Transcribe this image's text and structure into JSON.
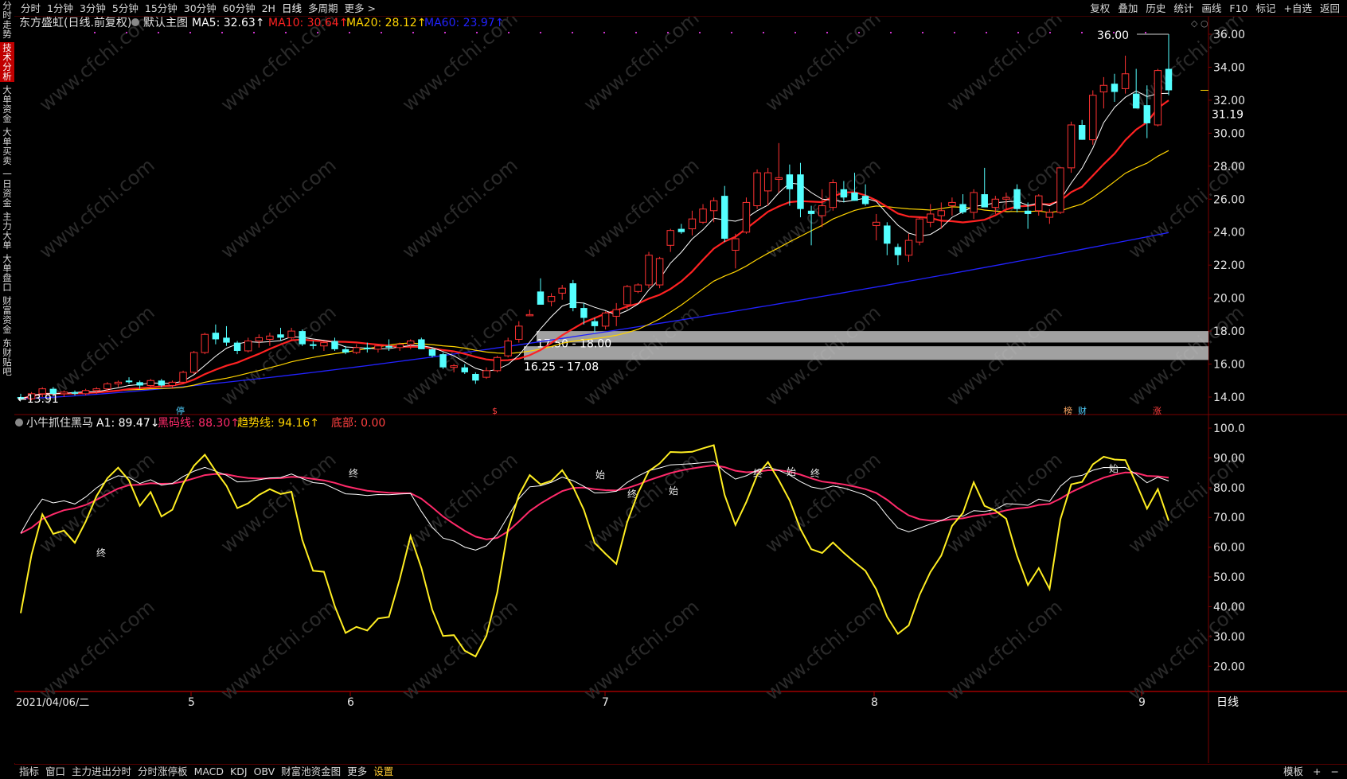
{
  "top_tabs": [
    "分时",
    "1分钟",
    "3分钟",
    "5分钟",
    "15分钟",
    "30分钟",
    "60分钟",
    "2H",
    "日线",
    "多周期",
    "更多 >"
  ],
  "top_tabs_selected": "日线",
  "top_right_buttons": [
    "复权",
    "叠加",
    "历史",
    "统计",
    "画线",
    "F10",
    "标记",
    "+自选",
    "返回"
  ],
  "sidebar_items": [
    "分时走势",
    "技术分析",
    "大单资金",
    "大单买卖",
    "一日资金",
    "主力大单",
    "大单盘口",
    "财富资金",
    "东财贴吧"
  ],
  "sidebar_active": "技术分析",
  "bottom_tabs": [
    "指标",
    "窗口",
    "主力进出分时",
    "分时涨停板",
    "MACD",
    "KDJ",
    "OBV",
    "财富池资金图",
    "更多",
    "设置"
  ],
  "bottom_tabs_selected": "设置",
  "bottom_right_buttons": [
    "模板",
    "+",
    "−"
  ],
  "main_panel": {
    "stock_title": "东方盛虹(日线.前复权)",
    "main_chart_label": "默认主图",
    "ma_labels": [
      {
        "text": "MA5: 32.63↑",
        "color": "#ffffff"
      },
      {
        "text": "MA10: 30.64↑",
        "color": "#ff2222"
      },
      {
        "text": "MA20: 28.12↑",
        "color": "#ffd400"
      },
      {
        "text": "MA60: 23.97↑",
        "color": "#2222ff"
      }
    ],
    "price_axis": [
      "36.00",
      "34.00",
      "32.00",
      "30.00",
      "28.00",
      "26.00",
      "24.00",
      "22.00",
      "20.00",
      "18.00",
      "16.00",
      "14.00"
    ],
    "current_price": "31.19",
    "high_marker": "36.00",
    "low_marker": "13.91",
    "zone_labels": [
      "17.50 - 18.00",
      "16.25 - 17.08"
    ],
    "event_markers": [
      {
        "text": "停",
        "color": "#50d0ff"
      },
      {
        "text": "$",
        "color": "#ff4040"
      },
      {
        "text": "榜",
        "color": "#ffaa66"
      },
      {
        "text": "财",
        "color": "#50d0ff"
      },
      {
        "text": "涨",
        "color": "#ff4040"
      }
    ],
    "watermark": "www.cfchi.com"
  },
  "sub_panel": {
    "title": "小牛抓住黑马",
    "labels": [
      {
        "text": "A1: 89.47↓",
        "color": "#ffffff"
      },
      {
        "text": "黑码线: 88.30↑",
        "color": "#ff2a6a"
      },
      {
        "text": "趋势线: 94.16↑",
        "color": "#ffd400"
      },
      {
        "text": "底部: 0.00",
        "color": "#ff4040"
      }
    ],
    "axis": [
      "100.0",
      "90.00",
      "80.00",
      "70.00",
      "60.00",
      "50.00",
      "40.00",
      "30.00",
      "20.00"
    ],
    "signal_markers": [
      "终",
      "终",
      "始",
      "终",
      "始",
      "终",
      "始",
      "终",
      "始"
    ]
  },
  "x_axis": {
    "date_label": "2021/04/06/二",
    "month_ticks": [
      "5",
      "6",
      "7",
      "8",
      "9"
    ]
  },
  "period_label": "日线",
  "colors": {
    "up": "#ff3232",
    "down": "#54ffff",
    "ma5": "#ffffff",
    "ma10": "#ff2222",
    "ma20": "#ffd400",
    "ma60": "#2222ff",
    "a1": "#ffffff",
    "black_horse": "#ff2a6a",
    "trend": "#ffee22",
    "axis_text": "#e6e6e6",
    "grid_border": "#7a0000"
  },
  "chart_data": {
    "type": "candlestick",
    "candles": [
      [
        14.0,
        14.2,
        13.8,
        13.91
      ],
      [
        13.9,
        14.3,
        13.8,
        14.2
      ],
      [
        14.2,
        14.6,
        14.0,
        14.5
      ],
      [
        14.5,
        14.6,
        14.1,
        14.2
      ],
      [
        14.2,
        14.4,
        14.0,
        14.3
      ],
      [
        14.3,
        14.4,
        14.1,
        14.2
      ],
      [
        14.2,
        14.5,
        14.1,
        14.4
      ],
      [
        14.4,
        14.6,
        14.2,
        14.5
      ],
      [
        14.5,
        14.9,
        14.3,
        14.8
      ],
      [
        14.8,
        15.0,
        14.6,
        14.9
      ],
      [
        15.0,
        15.2,
        14.8,
        14.9
      ],
      [
        14.9,
        15.0,
        14.5,
        14.7
      ],
      [
        14.7,
        15.1,
        14.6,
        15.0
      ],
      [
        15.0,
        15.1,
        14.6,
        14.7
      ],
      [
        14.7,
        15.0,
        14.5,
        14.9
      ],
      [
        14.9,
        15.6,
        14.8,
        15.5
      ],
      [
        15.5,
        16.8,
        15.4,
        16.7
      ],
      [
        16.7,
        17.9,
        16.6,
        17.8
      ],
      [
        17.9,
        18.4,
        17.2,
        17.5
      ],
      [
        17.6,
        18.3,
        17.1,
        17.3
      ],
      [
        17.3,
        17.4,
        16.6,
        16.8
      ],
      [
        16.8,
        17.6,
        16.7,
        17.4
      ],
      [
        17.4,
        17.8,
        17.0,
        17.6
      ],
      [
        17.5,
        17.9,
        17.1,
        17.7
      ],
      [
        17.8,
        18.2,
        17.4,
        17.6
      ],
      [
        17.6,
        18.2,
        17.4,
        18.0
      ],
      [
        18.0,
        18.1,
        17.1,
        17.2
      ],
      [
        17.2,
        17.4,
        16.9,
        17.1
      ],
      [
        17.1,
        17.4,
        16.8,
        17.3
      ],
      [
        17.4,
        17.6,
        16.8,
        16.9
      ],
      [
        16.9,
        17.1,
        16.6,
        16.7
      ],
      [
        16.7,
        17.2,
        16.6,
        17.0
      ],
      [
        17.0,
        17.3,
        16.7,
        16.9
      ],
      [
        16.9,
        17.2,
        16.7,
        17.1
      ],
      [
        17.1,
        17.5,
        16.8,
        17.0
      ],
      [
        17.0,
        17.3,
        16.8,
        17.2
      ],
      [
        17.2,
        17.5,
        16.9,
        17.4
      ],
      [
        17.5,
        17.6,
        16.9,
        16.9
      ],
      [
        16.9,
        17.0,
        16.4,
        16.5
      ],
      [
        16.6,
        16.7,
        15.7,
        15.8
      ],
      [
        15.8,
        16.0,
        15.5,
        15.9
      ],
      [
        15.8,
        16.0,
        15.4,
        15.5
      ],
      [
        15.4,
        15.5,
        14.8,
        15.0
      ],
      [
        15.2,
        15.8,
        15.1,
        15.6
      ],
      [
        15.6,
        16.5,
        15.5,
        16.4
      ],
      [
        16.5,
        17.6,
        16.4,
        17.4
      ],
      [
        17.5,
        18.6,
        17.3,
        18.3
      ],
      [
        19.0,
        19.3,
        18.9,
        19.0
      ],
      [
        20.4,
        21.2,
        19.8,
        19.6
      ],
      [
        19.8,
        20.3,
        19.5,
        20.1
      ],
      [
        20.3,
        20.8,
        19.9,
        20.6
      ],
      [
        20.9,
        21.1,
        19.2,
        19.4
      ],
      [
        19.4,
        19.7,
        18.4,
        18.8
      ],
      [
        18.6,
        18.8,
        17.9,
        18.3
      ],
      [
        18.3,
        19.2,
        18.1,
        19.1
      ],
      [
        18.9,
        19.7,
        18.3,
        19.3
      ],
      [
        19.6,
        20.8,
        19.3,
        20.7
      ],
      [
        20.4,
        20.9,
        20.3,
        20.8
      ],
      [
        20.8,
        22.8,
        20.6,
        22.6
      ],
      [
        20.8,
        22.5,
        20.6,
        22.4
      ],
      [
        23.2,
        24.2,
        22.8,
        24.1
      ],
      [
        24.2,
        24.5,
        23.9,
        24.0
      ],
      [
        24.2,
        25.3,
        23.8,
        24.8
      ],
      [
        24.6,
        25.7,
        24.5,
        25.4
      ],
      [
        25.3,
        26.1,
        24.6,
        25.9
      ],
      [
        26.2,
        26.8,
        23.4,
        23.6
      ],
      [
        22.9,
        23.9,
        21.8,
        23.6
      ],
      [
        24.0,
        26.1,
        23.9,
        25.8
      ],
      [
        25.6,
        27.8,
        25.4,
        27.6
      ],
      [
        26.5,
        27.9,
        25.6,
        27.6
      ],
      [
        27.2,
        29.4,
        26.4,
        27.3
      ],
      [
        27.5,
        28.1,
        25.6,
        26.6
      ],
      [
        27.5,
        28.2,
        24.9,
        25.4
      ],
      [
        25.3,
        25.6,
        23.2,
        25.1
      ],
      [
        25.0,
        26.6,
        24.3,
        25.6
      ],
      [
        25.5,
        27.2,
        25.3,
        27.0
      ],
      [
        26.6,
        27.1,
        25.8,
        26.1
      ],
      [
        26.4,
        27.6,
        25.9,
        25.9
      ],
      [
        26.2,
        26.9,
        25.6,
        25.7
      ],
      [
        24.4,
        25.1,
        23.5,
        24.6
      ],
      [
        24.4,
        24.6,
        22.6,
        23.3
      ],
      [
        23.1,
        23.3,
        22.0,
        22.6
      ],
      [
        22.6,
        23.9,
        22.2,
        23.5
      ],
      [
        23.4,
        24.9,
        23.2,
        24.8
      ],
      [
        24.6,
        25.7,
        24.3,
        25.1
      ],
      [
        25.0,
        25.8,
        24.2,
        25.3
      ],
      [
        25.6,
        26.1,
        25.0,
        25.8
      ],
      [
        25.7,
        26.3,
        25.1,
        25.2
      ],
      [
        25.2,
        26.6,
        24.8,
        26.4
      ],
      [
        26.3,
        27.9,
        26.1,
        25.5
      ],
      [
        25.5,
        26.2,
        25.1,
        26.0
      ],
      [
        26.0,
        26.4,
        25.4,
        26.1
      ],
      [
        26.6,
        26.9,
        25.2,
        25.4
      ],
      [
        25.3,
        25.8,
        24.2,
        25.1
      ],
      [
        25.3,
        26.3,
        25.0,
        26.2
      ],
      [
        24.9,
        25.4,
        24.5,
        25.2
      ],
      [
        25.2,
        27.9,
        25.1,
        27.9
      ],
      [
        27.9,
        30.7,
        27.6,
        30.5
      ],
      [
        30.5,
        30.8,
        29.6,
        29.6
      ],
      [
        29.6,
        32.6,
        29.3,
        32.3
      ],
      [
        32.5,
        33.4,
        31.5,
        32.9
      ],
      [
        33.0,
        33.6,
        31.9,
        32.5
      ],
      [
        32.7,
        34.7,
        32.4,
        33.6
      ],
      [
        32.4,
        33.9,
        31.7,
        31.5
      ],
      [
        31.7,
        32.9,
        29.7,
        30.6
      ],
      [
        30.5,
        33.9,
        30.4,
        33.8
      ],
      [
        33.9,
        36.0,
        32.3,
        32.6
      ]
    ],
    "ma60_range": [
      13.91,
      23.97
    ],
    "indicator": {
      "name": "小牛抓住黑马",
      "series": [
        {
          "name": "A1",
          "last": 89.47
        },
        {
          "name": "黑码线",
          "last": 88.3
        },
        {
          "name": "趋势线",
          "last": 94.16
        },
        {
          "name": "底部",
          "last": 0.0
        }
      ],
      "ylim": [
        15,
        100
      ]
    }
  }
}
